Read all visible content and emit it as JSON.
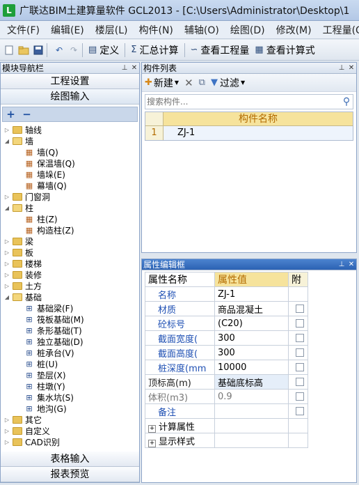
{
  "window": {
    "title": "广联达BIM土建算量软件 GCL2013 - [C:\\Users\\Administrator\\Desktop\\1"
  },
  "menu": [
    "文件(F)",
    "编辑(E)",
    "楼层(L)",
    "构件(N)",
    "辅轴(O)",
    "绘图(D)",
    "修改(M)",
    "工程量(Q)"
  ],
  "toolbar": {
    "define_label": "定义",
    "sum_label": "汇总计算",
    "view_qty_label": "查看工程量",
    "view_formula_label": "查看计算式"
  },
  "nav": {
    "title": "模块导航栏",
    "buttons": {
      "project_settings": "工程设置",
      "drawing_input": "绘图输入",
      "table_input": "表格输入",
      "report_preview": "报表预览"
    },
    "tree": [
      {
        "label": "轴线",
        "level": 0,
        "type": "folder",
        "expanded": false
      },
      {
        "label": "墙",
        "level": 0,
        "type": "folder",
        "expanded": true
      },
      {
        "label": "墙(Q)",
        "level": 1,
        "type": "leaf",
        "icon": "wall-icon"
      },
      {
        "label": "保温墙(Q)",
        "level": 1,
        "type": "leaf",
        "icon": "insulation-wall-icon"
      },
      {
        "label": "墙垛(E)",
        "level": 1,
        "type": "leaf",
        "icon": "wall-buttress-icon"
      },
      {
        "label": "幕墙(Q)",
        "level": 1,
        "type": "leaf",
        "icon": "curtain-wall-icon"
      },
      {
        "label": "门窗洞",
        "level": 0,
        "type": "folder",
        "expanded": false
      },
      {
        "label": "柱",
        "level": 0,
        "type": "folder",
        "expanded": true
      },
      {
        "label": "柱(Z)",
        "level": 1,
        "type": "leaf",
        "icon": "column-icon"
      },
      {
        "label": "构造柱(Z)",
        "level": 1,
        "type": "leaf",
        "icon": "constructional-column-icon"
      },
      {
        "label": "梁",
        "level": 0,
        "type": "folder",
        "expanded": false
      },
      {
        "label": "板",
        "level": 0,
        "type": "folder",
        "expanded": false
      },
      {
        "label": "楼梯",
        "level": 0,
        "type": "folder",
        "expanded": false
      },
      {
        "label": "装修",
        "level": 0,
        "type": "folder",
        "expanded": false
      },
      {
        "label": "土方",
        "level": 0,
        "type": "folder",
        "expanded": false
      },
      {
        "label": "基础",
        "level": 0,
        "type": "folder",
        "expanded": true
      },
      {
        "label": "基础梁(F)",
        "level": 1,
        "type": "leaf",
        "icon": "foundation-beam-icon"
      },
      {
        "label": "筏板基础(M)",
        "level": 1,
        "type": "leaf",
        "icon": "raft-foundation-icon"
      },
      {
        "label": "条形基础(T)",
        "level": 1,
        "type": "leaf",
        "icon": "strip-foundation-icon"
      },
      {
        "label": "独立基础(D)",
        "level": 1,
        "type": "leaf",
        "icon": "isolated-foundation-icon"
      },
      {
        "label": "桩承台(V)",
        "level": 1,
        "type": "leaf",
        "icon": "pile-cap-icon"
      },
      {
        "label": "桩(U)",
        "level": 1,
        "type": "leaf",
        "icon": "pile-icon"
      },
      {
        "label": "垫层(X)",
        "level": 1,
        "type": "leaf",
        "icon": "cushion-icon"
      },
      {
        "label": "柱墩(Y)",
        "level": 1,
        "type": "leaf",
        "icon": "column-pier-icon"
      },
      {
        "label": "集水坑(S)",
        "level": 1,
        "type": "leaf",
        "icon": "sump-pit-icon"
      },
      {
        "label": "地沟(G)",
        "level": 1,
        "type": "leaf",
        "icon": "trench-icon"
      },
      {
        "label": "其它",
        "level": 0,
        "type": "folder",
        "expanded": false
      },
      {
        "label": "自定义",
        "level": 0,
        "type": "folder",
        "expanded": false
      },
      {
        "label": "CAD识别",
        "level": 0,
        "type": "folder",
        "expanded": false
      }
    ]
  },
  "components": {
    "title": "构件列表",
    "new_label": "新建",
    "filter_label": "过滤",
    "search_placeholder": "搜索构件...",
    "column_header": "构件名称",
    "rows": [
      {
        "index": "1",
        "name": "ZJ-1"
      }
    ]
  },
  "properties": {
    "title": "属性编辑框",
    "headers": {
      "name": "属性名称",
      "value": "属性值",
      "attach": "附"
    },
    "rows": [
      {
        "name": "名称",
        "value": "ZJ-1",
        "checkbox": false
      },
      {
        "name": "材质",
        "value": "商品混凝土",
        "checkbox": true
      },
      {
        "name": "砼标号",
        "value": "(C20)",
        "checkbox": true
      },
      {
        "name": "截面宽度(",
        "value": "300",
        "checkbox": true
      },
      {
        "name": "截面高度(",
        "value": "300",
        "checkbox": true
      },
      {
        "name": "桩深度(mm",
        "value": "10000",
        "checkbox": true
      },
      {
        "name": "顶标高(m)",
        "value": "基础底标高",
        "checkbox": true
      },
      {
        "name": "体积(m3)",
        "value": "0.9",
        "checkbox": true
      },
      {
        "name": "备注",
        "value": "",
        "checkbox": true
      }
    ],
    "groups": [
      "计算属性",
      "显示样式"
    ]
  }
}
